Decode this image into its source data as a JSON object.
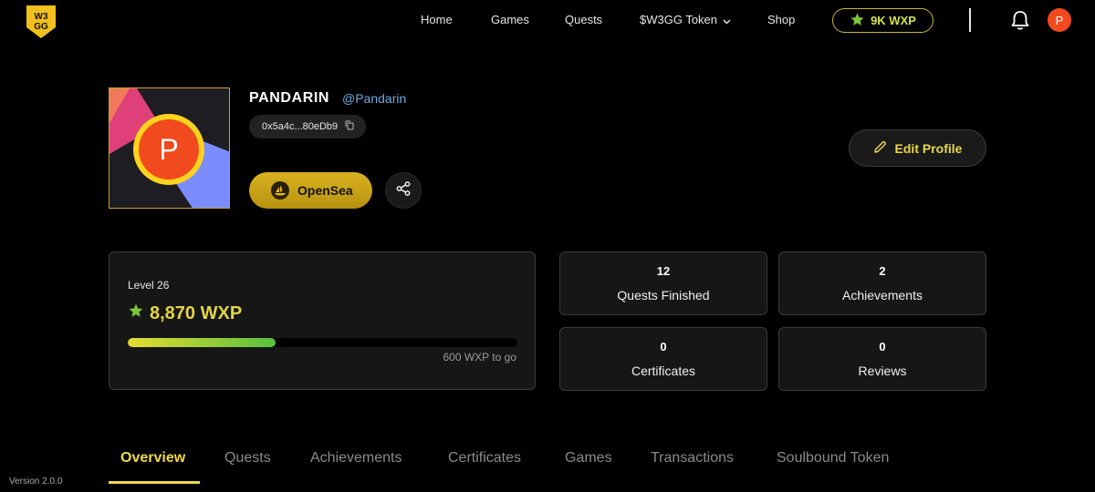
{
  "nav": {
    "logo_text": "W3GG",
    "links": [
      "Home",
      "Games",
      "Quests",
      "$W3GG Token",
      "Shop"
    ],
    "wxp_badge": "9K WXP",
    "avatar_initial": "P",
    "icons": [
      "logo-icon",
      "star-icon",
      "chevron-down-icon",
      "bell-icon"
    ]
  },
  "profile": {
    "name": "PANDARIN",
    "handle": "@Pandarin",
    "wallet": "0x5a4c...80eDb9",
    "avatar_initial": "P",
    "opensea_label": "OpenSea",
    "edit_label": "Edit Profile"
  },
  "level": {
    "label": "Level 26",
    "wxp": "8,870 WXP",
    "progress_fraction": 0.38,
    "to_go": "600 WXP to go"
  },
  "stats": [
    {
      "value": "12",
      "label": "Quests Finished"
    },
    {
      "value": "2",
      "label": "Achievements"
    },
    {
      "value": "0",
      "label": "Certificates"
    },
    {
      "value": "0",
      "label": "Reviews"
    }
  ],
  "tabs": [
    "Overview",
    "Quests",
    "Achievements",
    "Certificates",
    "Games",
    "Transactions",
    "Soulbound Token"
  ],
  "active_tab": "Overview",
  "footer": {
    "version": "Version 2.0.0"
  },
  "colors": {
    "accent": "#f0d84a",
    "wxp": "#e2d54a",
    "avatar": "#f04a1e",
    "handle": "#6ea8dd",
    "card_bg": "#161616"
  }
}
